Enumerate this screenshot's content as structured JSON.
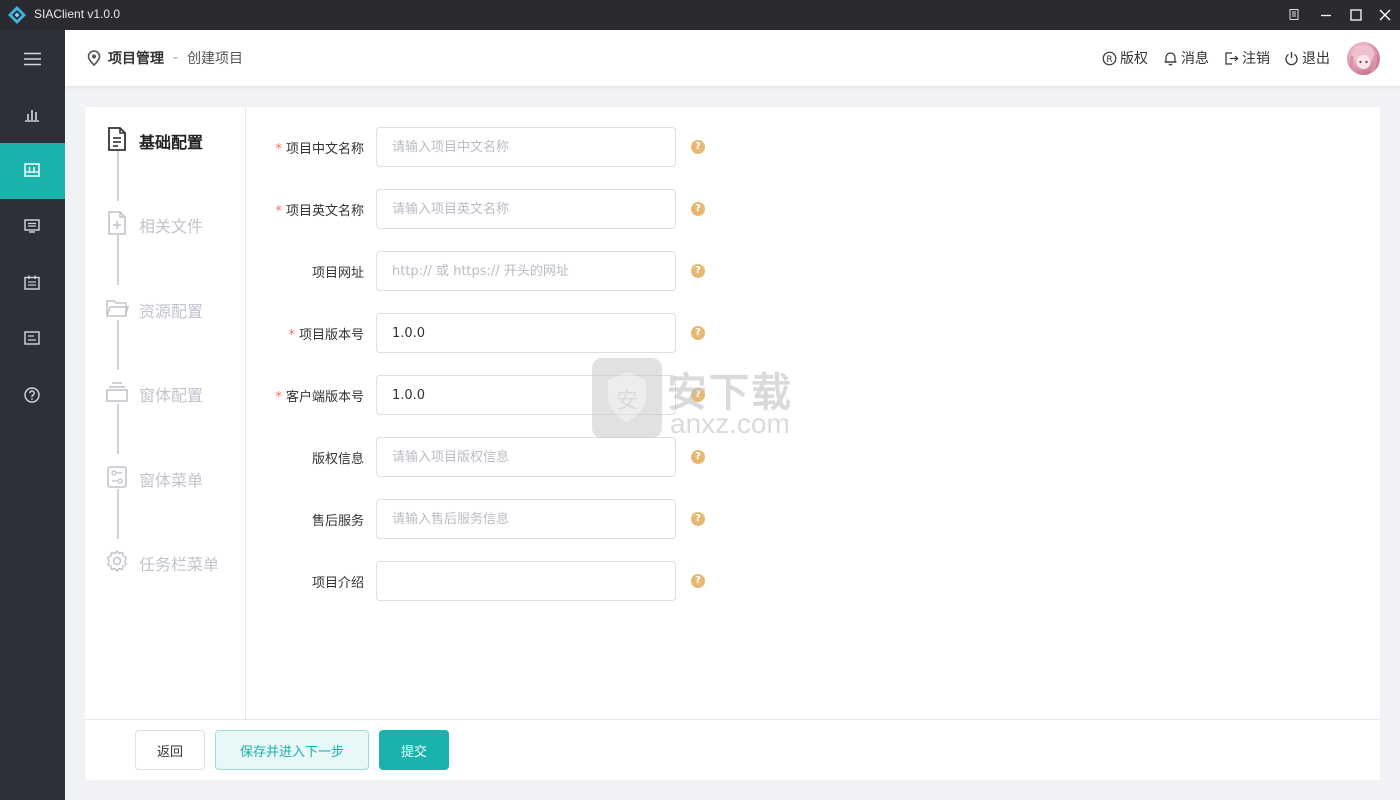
{
  "window": {
    "title": "SIAClient v1.0.0"
  },
  "breadcrumb": {
    "section": "项目管理",
    "separator": "-",
    "page": "创建项目"
  },
  "header_actions": [
    {
      "label": "版权",
      "icon": "copyright-icon"
    },
    {
      "label": "消息",
      "icon": "bell-icon"
    },
    {
      "label": "注销",
      "icon": "logout-icon"
    },
    {
      "label": "退出",
      "icon": "power-icon"
    }
  ],
  "sidebar": {
    "items": [
      {
        "icon": "menu-icon"
      },
      {
        "icon": "chart-icon"
      },
      {
        "icon": "project-icon",
        "active": true
      },
      {
        "icon": "monitor-icon"
      },
      {
        "icon": "calendar-icon"
      },
      {
        "icon": "document-icon"
      },
      {
        "icon": "help-icon"
      }
    ],
    "accent": "#1ab2ad"
  },
  "steps": [
    {
      "label": "基础配置",
      "icon": "file-text-icon",
      "active": true
    },
    {
      "label": "相关文件",
      "icon": "file-add-icon"
    },
    {
      "label": "资源配置",
      "icon": "folder-icon"
    },
    {
      "label": "窗体配置",
      "icon": "window-icon"
    },
    {
      "label": "窗体菜单",
      "icon": "menu-settings-icon"
    },
    {
      "label": "任务栏菜单",
      "icon": "gear-icon"
    }
  ],
  "form": {
    "fields": [
      {
        "label": "项目中文名称",
        "required": true,
        "value": "",
        "placeholder": "请输入项目中文名称"
      },
      {
        "label": "项目英文名称",
        "required": true,
        "value": "",
        "placeholder": "请输入项目英文名称"
      },
      {
        "label": "项目网址",
        "required": false,
        "value": "",
        "placeholder": "http:// 或 https:// 开头的网址"
      },
      {
        "label": "项目版本号",
        "required": true,
        "value": "1.0.0",
        "placeholder": ""
      },
      {
        "label": "客户端版本号",
        "required": true,
        "value": "1.0.0",
        "placeholder": ""
      },
      {
        "label": "版权信息",
        "required": false,
        "value": "",
        "placeholder": "请输入项目版权信息"
      },
      {
        "label": "售后服务",
        "required": false,
        "value": "",
        "placeholder": "请输入售后服务信息"
      },
      {
        "label": "项目介绍",
        "required": false,
        "value": "",
        "placeholder": ""
      }
    ],
    "required_mark": "*",
    "help_mark": "?"
  },
  "footer": {
    "back_label": "返回",
    "next_label": "保存并进入下一步",
    "submit_label": "提交"
  },
  "watermark": {
    "text": "安下载",
    "domain": "anxz.com"
  }
}
